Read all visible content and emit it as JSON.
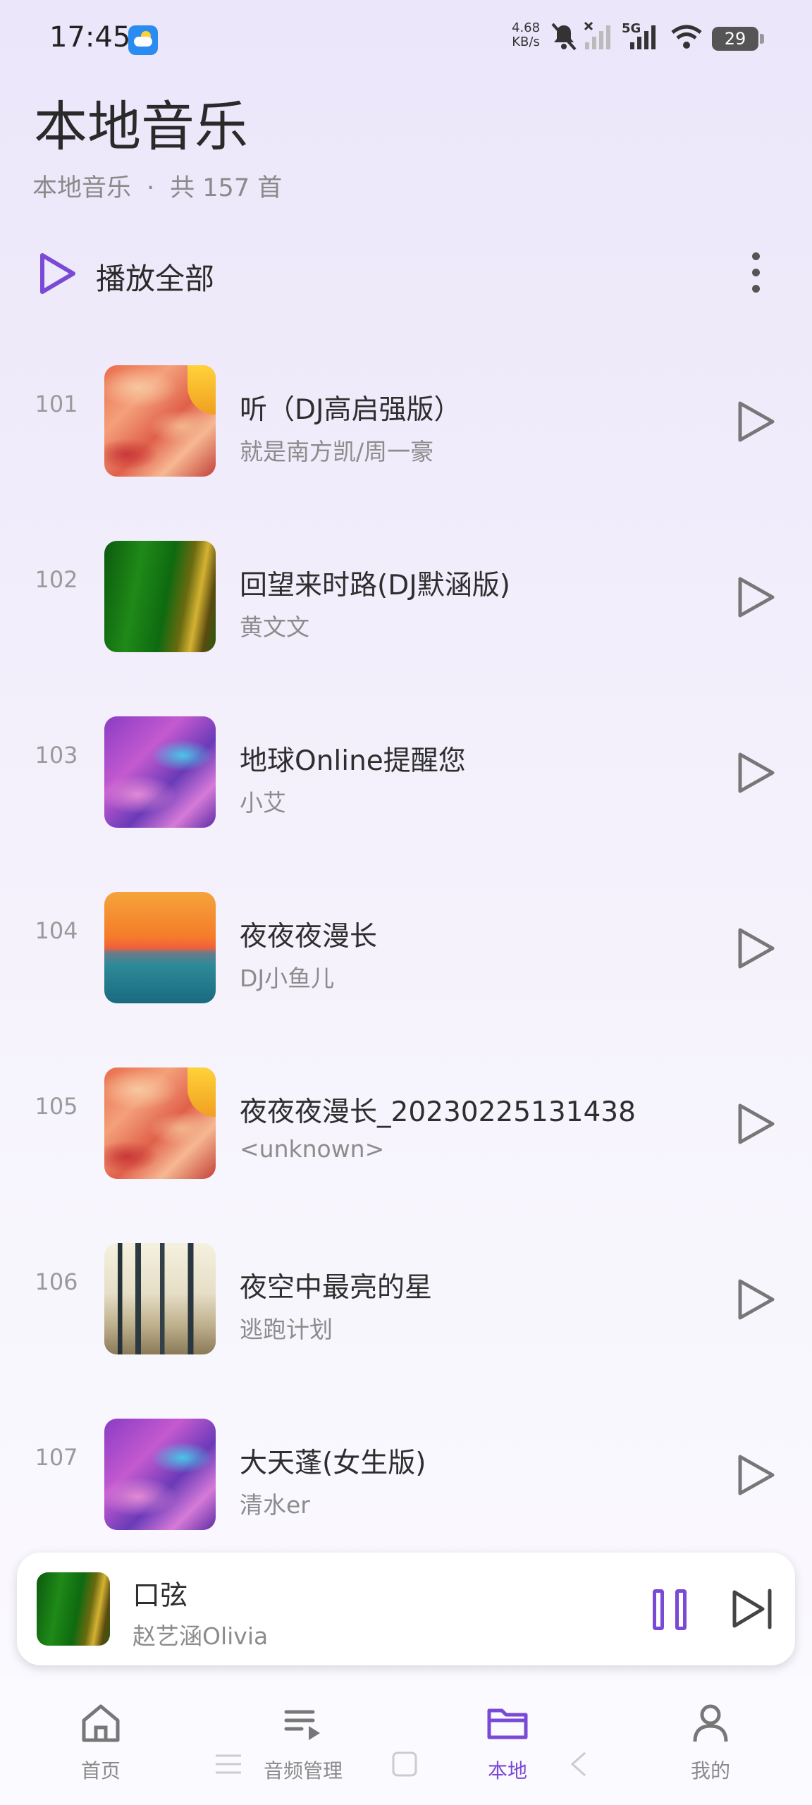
{
  "status_bar": {
    "time": "17:45",
    "net_speed_value": "4.68",
    "net_speed_unit": "KB/s",
    "network_label": "5G",
    "battery": "29"
  },
  "header": {
    "title": "本地音乐",
    "subtitle_source": "本地音乐",
    "subtitle_separator": "·",
    "subtitle_count": "共 157 首"
  },
  "toolbar": {
    "play_all_label": "播放全部",
    "accent_color": "#7a4ad6"
  },
  "songs": [
    {
      "index": "101",
      "title": "听（DJ高启强版）",
      "artist": "就是南方凯/周一豪",
      "cover": "swirl-red"
    },
    {
      "index": "102",
      "title": "回望来时路(DJ默涵版)",
      "artist": "黄文文",
      "cover": "green"
    },
    {
      "index": "103",
      "title": "地球Online提醒您",
      "artist": "小艾",
      "cover": "purple"
    },
    {
      "index": "104",
      "title": "夜夜夜漫长",
      "artist": "DJ小鱼儿",
      "cover": "sunset"
    },
    {
      "index": "105",
      "title": "夜夜夜漫长_20230225131438",
      "artist": "<unknown>",
      "cover": "swirl-red"
    },
    {
      "index": "106",
      "title": "夜空中最亮的星",
      "artist": "逃跑计划",
      "cover": "forest"
    },
    {
      "index": "107",
      "title": "大天蓬(女生版)",
      "artist": "清水er",
      "cover": "purple"
    }
  ],
  "now_playing": {
    "title": "口弦",
    "artist": "赵艺涵Olivia",
    "cover": "green"
  },
  "bottom_nav": {
    "items": [
      {
        "label": "首页",
        "icon": "home-icon",
        "active": false
      },
      {
        "label": "音频管理",
        "icon": "playlist-icon",
        "active": false
      },
      {
        "label": "本地",
        "icon": "folder-icon",
        "active": true
      },
      {
        "label": "我的",
        "icon": "person-icon",
        "active": false
      }
    ]
  }
}
